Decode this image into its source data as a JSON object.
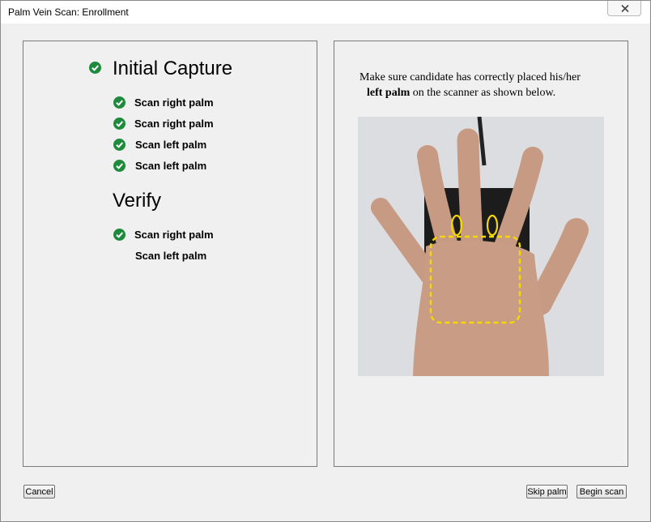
{
  "window": {
    "title": "Palm Vein Scan: Enrollment"
  },
  "initial_capture": {
    "title": "Initial Capture",
    "completed": true,
    "steps": [
      {
        "label": "Scan right palm",
        "completed": true
      },
      {
        "label": "Scan right palm",
        "completed": true
      },
      {
        "label": "Scan left palm",
        "completed": true
      },
      {
        "label": "Scan left palm",
        "completed": true
      }
    ]
  },
  "verify": {
    "title": "Verify",
    "steps": [
      {
        "label": "Scan right palm",
        "completed": true
      },
      {
        "label": "Scan left palm",
        "completed": false
      }
    ]
  },
  "instructions": {
    "line1": "Make sure candidate has correctly placed his/her",
    "bold": "left palm",
    "line2_rest": " on the scanner as shown below."
  },
  "buttons": {
    "cancel": "Cancel",
    "skip_palm": "Skip palm",
    "begin_scan": "Begin scan"
  },
  "icons": {
    "check": "check-circle-icon",
    "close": "close-icon"
  },
  "colors": {
    "check_green": "#1e8a3c",
    "scan_outline": "#f5d800"
  }
}
